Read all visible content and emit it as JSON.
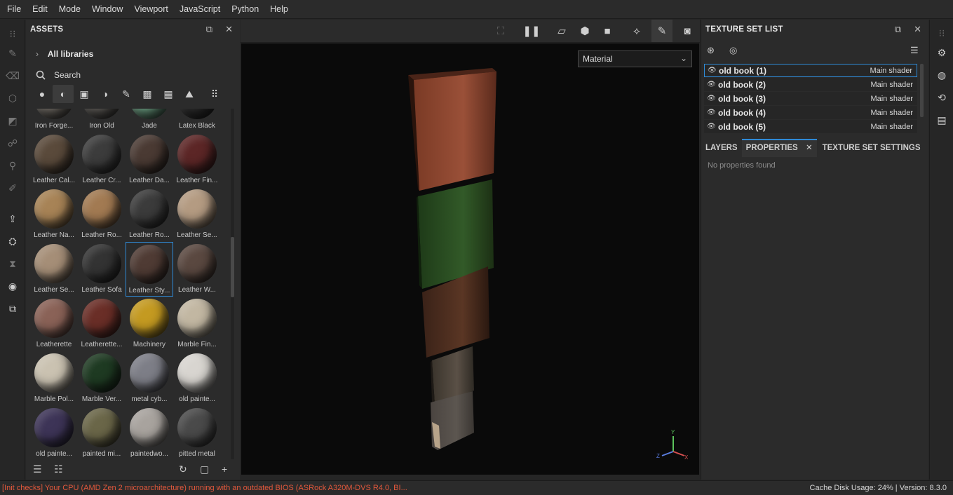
{
  "menu": [
    "File",
    "Edit",
    "Mode",
    "Window",
    "Viewport",
    "JavaScript",
    "Python",
    "Help"
  ],
  "assets": {
    "title": "ASSETS",
    "all_libraries": "All libraries",
    "search_label": "Search",
    "materials": [
      {
        "name": "Iron Forge...",
        "color": "#6f6a63"
      },
      {
        "name": "Iron Old",
        "color": "#5d5a56"
      },
      {
        "name": "Jade",
        "color": "#6a9c80"
      },
      {
        "name": "Latex Black",
        "color": "#2c2c2c"
      },
      {
        "name": "Leather Cal...",
        "color": "#5a4a3b"
      },
      {
        "name": "Leather Cr...",
        "color": "#3c3c3c"
      },
      {
        "name": "Leather Da...",
        "color": "#4a3a33"
      },
      {
        "name": "Leather Fin...",
        "color": "#5c2626"
      },
      {
        "name": "Leather Na...",
        "color": "#a78356"
      },
      {
        "name": "Leather Ro...",
        "color": "#a27a52"
      },
      {
        "name": "Leather Ro...",
        "color": "#3b3b3b"
      },
      {
        "name": "Leather Se...",
        "color": "#b49b82"
      },
      {
        "name": "Leather Se...",
        "color": "#a58e77"
      },
      {
        "name": "Leather Sofa",
        "color": "#333333"
      },
      {
        "name": "Leather Sty...",
        "color": "#4f3b34"
      },
      {
        "name": "Leather W...",
        "color": "#5a4840"
      },
      {
        "name": "Leatherette",
        "color": "#8a6257"
      },
      {
        "name": "Leatherette...",
        "color": "#6a2e27"
      },
      {
        "name": "Machinery",
        "color": "#c49a21"
      },
      {
        "name": "Marble Fin...",
        "color": "#c2b7a2"
      },
      {
        "name": "Marble Pol...",
        "color": "#cac2b1"
      },
      {
        "name": "Marble Ver...",
        "color": "#1e3a22"
      },
      {
        "name": "metal cyb...",
        "color": "#7d7e87"
      },
      {
        "name": "old painte...",
        "color": "#d8d5d0"
      },
      {
        "name": "old painte...",
        "color": "#3d3457"
      },
      {
        "name": "painted mi...",
        "color": "#6a6648"
      },
      {
        "name": "paintedwo...",
        "color": "#a8a39e"
      },
      {
        "name": "pitted metal",
        "color": "#4a4a4a"
      }
    ],
    "selected_index": 14
  },
  "viewport": {
    "material_mode": "Material"
  },
  "texture_set_list": {
    "title": "TEXTURE SET LIST",
    "items": [
      {
        "name": "old book (1)",
        "shader": "Main shader"
      },
      {
        "name": "old book (2)",
        "shader": "Main shader"
      },
      {
        "name": "old book (3)",
        "shader": "Main shader"
      },
      {
        "name": "old book (4)",
        "shader": "Main shader"
      },
      {
        "name": "old book (5)",
        "shader": "Main shader"
      }
    ]
  },
  "tabs": {
    "layers": "LAYERS",
    "properties": "PROPERTIES",
    "texture_set_settings": "TEXTURE SET SETTINGS"
  },
  "properties": {
    "empty_message": "No properties found"
  },
  "status": {
    "warning": "[Init checks] Your CPU (AMD Zen 2 microarchitecture) running with an outdated BIOS (ASRock A320M-DVS R4.0, BI...",
    "cache": "Cache Disk Usage:   24% | Version: 8.3.0"
  },
  "axis": {
    "y": "Y",
    "x": "X",
    "z": "Z"
  }
}
